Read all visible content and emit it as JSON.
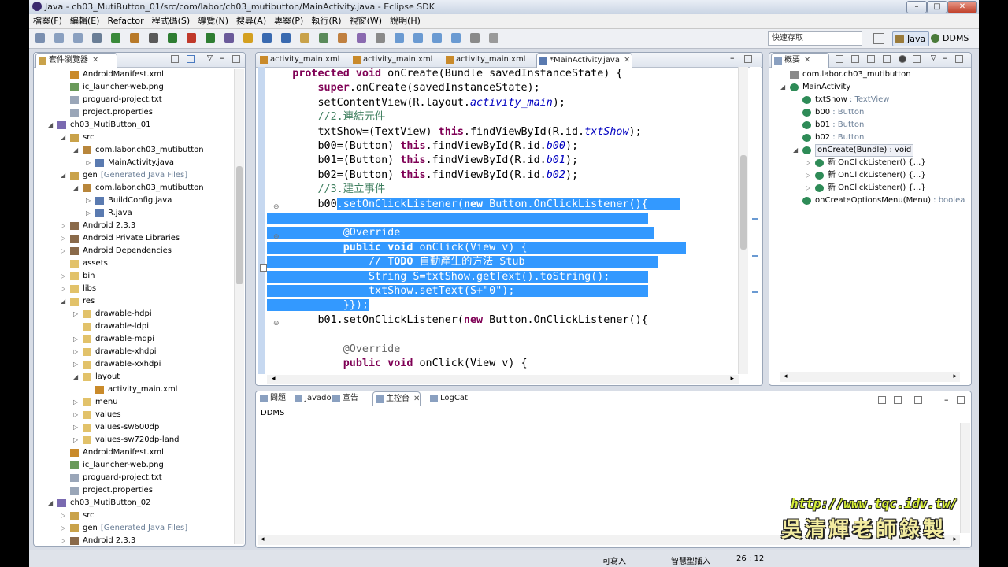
{
  "window": {
    "title": "Java - ch03_MutiButton_01/src/com/labor/ch03_mutibutton/MainActivity.java - Eclipse SDK"
  },
  "menu": [
    "檔案(F)",
    "編輯(E)",
    "Refactor",
    "程式碼(S)",
    "導覽(N)",
    "搜尋(A)",
    "專案(P)",
    "執行(R)",
    "視窗(W)",
    "說明(H)"
  ],
  "toolbar": {
    "quick_access": "快速存取",
    "perspectives": [
      "Java",
      "DDMS"
    ]
  },
  "explorer": {
    "title": "套件瀏覽器",
    "rows": [
      {
        "label": "AndroidManifest.xml",
        "icon": "xml-file-icon",
        "lvl": 2,
        "tw": ""
      },
      {
        "label": "ic_launcher-web.png",
        "icon": "image-file-icon",
        "lvl": 2,
        "tw": ""
      },
      {
        "label": "proguard-project.txt",
        "icon": "text-file-icon",
        "lvl": 2,
        "tw": ""
      },
      {
        "label": "project.properties",
        "icon": "text-file-icon",
        "lvl": 2,
        "tw": ""
      },
      {
        "label": "ch03_MutiButton_01",
        "icon": "project-icon",
        "lvl": 1,
        "tw": "◢"
      },
      {
        "label": "src",
        "icon": "source-folder-icon",
        "lvl": 2,
        "tw": "◢"
      },
      {
        "label": "com.labor.ch03_mutibutton",
        "icon": "package-icon",
        "lvl": 3,
        "tw": "◢"
      },
      {
        "label": "MainActivity.java",
        "icon": "java-file-icon",
        "lvl": 4,
        "tw": "▷"
      },
      {
        "label": "gen",
        "suffix": "[Generated Java Files]",
        "icon": "source-folder-icon",
        "lvl": 2,
        "tw": "◢"
      },
      {
        "label": "com.labor.ch03_mutibutton",
        "icon": "package-icon",
        "lvl": 3,
        "tw": "◢"
      },
      {
        "label": "BuildConfig.java",
        "icon": "java-file-icon",
        "lvl": 4,
        "tw": "▷"
      },
      {
        "label": "R.java",
        "icon": "java-file-icon",
        "lvl": 4,
        "tw": "▷"
      },
      {
        "label": "Android 2.3.3",
        "icon": "library-icon",
        "lvl": 2,
        "tw": "▷"
      },
      {
        "label": "Android Private Libraries",
        "icon": "library-icon",
        "lvl": 2,
        "tw": "▷"
      },
      {
        "label": "Android Dependencies",
        "icon": "library-icon",
        "lvl": 2,
        "tw": "▷"
      },
      {
        "label": "assets",
        "icon": "folder-icon",
        "lvl": 2,
        "tw": ""
      },
      {
        "label": "bin",
        "icon": "folder-icon",
        "lvl": 2,
        "tw": "▷"
      },
      {
        "label": "libs",
        "icon": "folder-icon",
        "lvl": 2,
        "tw": "▷"
      },
      {
        "label": "res",
        "icon": "folder-icon",
        "lvl": 2,
        "tw": "◢"
      },
      {
        "label": "drawable-hdpi",
        "icon": "folder-icon",
        "lvl": 3,
        "tw": "▷"
      },
      {
        "label": "drawable-ldpi",
        "icon": "folder-icon",
        "lvl": 3,
        "tw": ""
      },
      {
        "label": "drawable-mdpi",
        "icon": "folder-icon",
        "lvl": 3,
        "tw": "▷"
      },
      {
        "label": "drawable-xhdpi",
        "icon": "folder-icon",
        "lvl": 3,
        "tw": "▷"
      },
      {
        "label": "drawable-xxhdpi",
        "icon": "folder-icon",
        "lvl": 3,
        "tw": "▷"
      },
      {
        "label": "layout",
        "icon": "folder-icon",
        "lvl": 3,
        "tw": "◢"
      },
      {
        "label": "activity_main.xml",
        "icon": "xml-file-icon",
        "lvl": 4,
        "tw": ""
      },
      {
        "label": "menu",
        "icon": "folder-icon",
        "lvl": 3,
        "tw": "▷"
      },
      {
        "label": "values",
        "icon": "folder-icon",
        "lvl": 3,
        "tw": "▷"
      },
      {
        "label": "values-sw600dp",
        "icon": "folder-icon",
        "lvl": 3,
        "tw": "▷"
      },
      {
        "label": "values-sw720dp-land",
        "icon": "folder-icon",
        "lvl": 3,
        "tw": "▷"
      },
      {
        "label": "AndroidManifest.xml",
        "icon": "xml-file-icon",
        "lvl": 2,
        "tw": ""
      },
      {
        "label": "ic_launcher-web.png",
        "icon": "image-file-icon",
        "lvl": 2,
        "tw": ""
      },
      {
        "label": "proguard-project.txt",
        "icon": "text-file-icon",
        "lvl": 2,
        "tw": ""
      },
      {
        "label": "project.properties",
        "icon": "text-file-icon",
        "lvl": 2,
        "tw": ""
      },
      {
        "label": "ch03_MutiButton_02",
        "icon": "project-icon",
        "lvl": 1,
        "tw": "◢"
      },
      {
        "label": "src",
        "icon": "source-folder-icon",
        "lvl": 2,
        "tw": "▷"
      },
      {
        "label": "gen",
        "suffix": "[Generated Java Files]",
        "icon": "source-folder-icon",
        "lvl": 2,
        "tw": "▷"
      },
      {
        "label": "Android 2.3.3",
        "icon": "library-icon",
        "lvl": 2,
        "tw": "▷"
      }
    ]
  },
  "editor": {
    "tabs": [
      "activity_main.xml",
      "activity_main.xml",
      "activity_main.xml",
      "*MainActivity.java"
    ],
    "lines": [
      [
        {
          "t": "    "
        },
        {
          "t": "protected",
          "c": "kw"
        },
        {
          "t": " "
        },
        {
          "t": "void",
          "c": "kw"
        },
        {
          "t": " onCreate(Bundle savedInstanceState) {"
        }
      ],
      [
        {
          "t": "        "
        },
        {
          "t": "super",
          "c": "kw"
        },
        {
          "t": ".onCreate(savedInstanceState);"
        }
      ],
      [
        {
          "t": "        setContentView(R.layout."
        },
        {
          "t": "activity_main",
          "c": "it"
        },
        {
          "t": ");"
        }
      ],
      [
        {
          "t": "        "
        },
        {
          "t": "//2.連結元件",
          "c": "cm"
        }
      ],
      [
        {
          "t": "        txtShow=(TextView) "
        },
        {
          "t": "this",
          "c": "kw"
        },
        {
          "t": ".findViewById(R.id."
        },
        {
          "t": "txtShow",
          "c": "it"
        },
        {
          "t": ");"
        }
      ],
      [
        {
          "t": "        b00=(Button) "
        },
        {
          "t": "this",
          "c": "kw"
        },
        {
          "t": ".findViewById(R.id."
        },
        {
          "t": "b00",
          "c": "it"
        },
        {
          "t": ");"
        }
      ],
      [
        {
          "t": "        b01=(Button) "
        },
        {
          "t": "this",
          "c": "kw"
        },
        {
          "t": ".findViewById(R.id."
        },
        {
          "t": "b01",
          "c": "it"
        },
        {
          "t": ");"
        }
      ],
      [
        {
          "t": "        b02=(Button) "
        },
        {
          "t": "this",
          "c": "kw"
        },
        {
          "t": ".findViewById(R.id."
        },
        {
          "t": "b02",
          "c": "it"
        },
        {
          "t": ");"
        }
      ],
      [
        {
          "t": "        "
        },
        {
          "t": "//3.建立事件",
          "c": "cm"
        }
      ],
      [
        {
          "t": "        b00"
        },
        {
          "t": ".setOnClickListener(",
          "s": 1
        },
        {
          "t": "new",
          "c": "kw",
          "s": 1
        },
        {
          "t": " Button.OnClickListener(){     ",
          "s": 1
        }
      ],
      [
        {
          "t": "                                                            ",
          "s": 1
        }
      ],
      [
        {
          "t": "            ",
          "s": 1
        },
        {
          "t": "@Override",
          "c": "an",
          "s": 1
        },
        {
          "t": "                                        ",
          "s": 1
        }
      ],
      [
        {
          "t": "            ",
          "s": 1
        },
        {
          "t": "public",
          "c": "kw",
          "s": 1
        },
        {
          "t": " ",
          "s": 1
        },
        {
          "t": "void",
          "c": "kw",
          "s": 1
        },
        {
          "t": " onClick(View v) {                         ",
          "s": 1
        }
      ],
      [
        {
          "t": "                ",
          "s": 1
        },
        {
          "t": "// ",
          "c": "cm",
          "s": 1
        },
        {
          "t": "TODO",
          "c": "kw",
          "s": 1
        },
        {
          "t": " 自動產生的方法 Stub                     ",
          "c": "cm",
          "s": 1
        }
      ],
      [
        {
          "t": "                String S=txtShow.getText().toString();      ",
          "s": 1
        }
      ],
      [
        {
          "t": "                txtShow.setText(S+\"0\");                     ",
          "s": 1
        }
      ],
      [
        {
          "t": "            }});",
          "s": 1
        }
      ],
      [
        {
          "t": "        b01.setOnClickListener("
        },
        {
          "t": "new",
          "c": "kw"
        },
        {
          "t": " Button.OnClickListener(){"
        }
      ],
      [
        {
          "t": ""
        }
      ],
      [
        {
          "t": "            "
        },
        {
          "t": "@Override",
          "c": "an"
        }
      ],
      [
        {
          "t": "            "
        },
        {
          "t": "public",
          "c": "kw"
        },
        {
          "t": " "
        },
        {
          "t": "void",
          "c": "kw"
        },
        {
          "t": " onClick(View v) {"
        }
      ]
    ]
  },
  "outline": {
    "title": "概要",
    "rows": [
      {
        "label": "com.labor.ch03_mutibutton",
        "icon": "import-icon",
        "lvl": 1,
        "tw": ""
      },
      {
        "label": "MainActivity",
        "icon": "class-icon",
        "lvl": 1,
        "tw": "◢"
      },
      {
        "label": "txtShow",
        "type": " : TextView",
        "icon": "field-icon",
        "lvl": 2,
        "tw": ""
      },
      {
        "label": "b00",
        "type": " : Button",
        "icon": "field-icon",
        "lvl": 2,
        "tw": ""
      },
      {
        "label": "b01",
        "type": " : Button",
        "icon": "field-icon",
        "lvl": 2,
        "tw": ""
      },
      {
        "label": "b02",
        "type": " : Button",
        "icon": "field-icon",
        "lvl": 2,
        "tw": ""
      },
      {
        "label": "onCreate(Bundle) : void",
        "icon": "method-icon",
        "lvl": 2,
        "tw": "◢",
        "selected": true
      },
      {
        "label": "新 OnClickListener() {...}",
        "icon": "anonymous-class-icon",
        "lvl": 3,
        "tw": "▷"
      },
      {
        "label": "新 OnClickListener() {...}",
        "icon": "anonymous-class-icon",
        "lvl": 3,
        "tw": "▷"
      },
      {
        "label": "新 OnClickListener() {...}",
        "icon": "anonymous-class-icon",
        "lvl": 3,
        "tw": "▷"
      },
      {
        "label": "onCreateOptionsMenu(Menu)",
        "type": " : boolea",
        "icon": "method-icon",
        "lvl": 2,
        "tw": ""
      }
    ]
  },
  "bottom": {
    "tabs": [
      "問題",
      "Javadoc",
      "宣告",
      "主控台",
      "LogCat"
    ],
    "console": "DDMS"
  },
  "status": {
    "writable": "可寫入",
    "insert_mode": "智慧型插入",
    "position": "26 : 12"
  },
  "watermark": {
    "url": "http://www.tqc.idv.tw/",
    "author": "吳清輝老師錄製"
  },
  "colors": {
    "selection": "#3399ff",
    "keyword": "#7f0055",
    "comment": "#3f7f5f",
    "field": "#0000c0"
  }
}
